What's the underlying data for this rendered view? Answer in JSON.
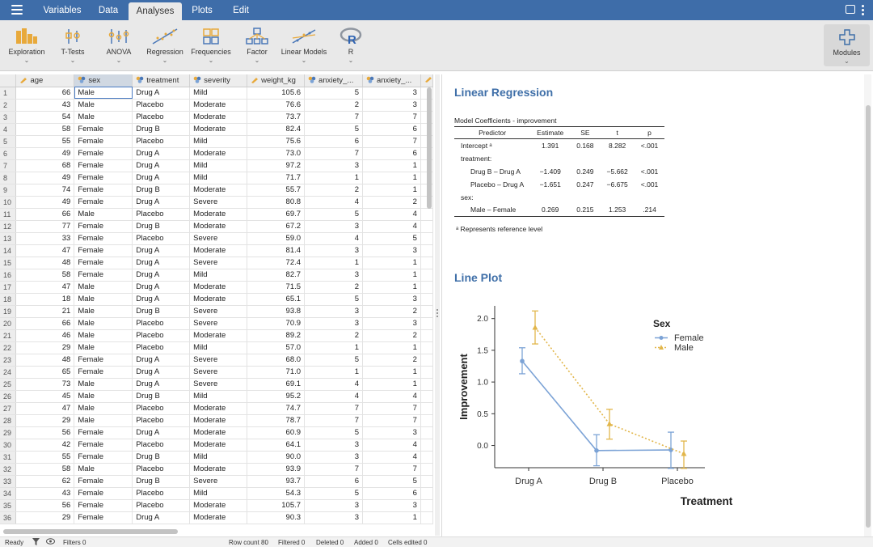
{
  "menu": {
    "tabs": [
      {
        "label": "Variables"
      },
      {
        "label": "Data"
      },
      {
        "label": "Analyses"
      },
      {
        "label": "Plots"
      },
      {
        "label": "Edit"
      }
    ]
  },
  "ribbon": {
    "buttons": [
      {
        "label": "Exploration",
        "icon": "exploration-icon"
      },
      {
        "label": "T-Tests",
        "icon": "ttests-icon"
      },
      {
        "label": "ANOVA",
        "icon": "anova-icon"
      },
      {
        "label": "Regression",
        "icon": "regression-icon"
      },
      {
        "label": "Frequencies",
        "icon": "frequencies-icon"
      },
      {
        "label": "Factor",
        "icon": "factor-icon"
      },
      {
        "label": "Linear Models",
        "icon": "linear-models-icon"
      },
      {
        "label": "R",
        "icon": "r-icon"
      }
    ],
    "modules_label": "Modules"
  },
  "grid": {
    "columns": [
      {
        "label": "age",
        "type": "continuous"
      },
      {
        "label": "sex",
        "type": "nominal"
      },
      {
        "label": "treatment",
        "type": "nominal"
      },
      {
        "label": "severity",
        "type": "nominal"
      },
      {
        "label": "weight_kg",
        "type": "continuous"
      },
      {
        "label": "anxiety_...",
        "type": "nominal"
      },
      {
        "label": "anxiety_...",
        "type": "nominal"
      }
    ],
    "rows": [
      [
        "1",
        "66",
        "Male",
        "Drug A",
        "Mild",
        "105.6",
        "5",
        "3"
      ],
      [
        "2",
        "43",
        "Male",
        "Placebo",
        "Moderate",
        "76.6",
        "2",
        "3"
      ],
      [
        "3",
        "54",
        "Male",
        "Placebo",
        "Moderate",
        "73.7",
        "7",
        "7"
      ],
      [
        "4",
        "58",
        "Female",
        "Drug B",
        "Moderate",
        "82.4",
        "5",
        "6"
      ],
      [
        "5",
        "55",
        "Female",
        "Placebo",
        "Mild",
        "75.6",
        "6",
        "7"
      ],
      [
        "6",
        "49",
        "Female",
        "Drug A",
        "Moderate",
        "73.0",
        "7",
        "6"
      ],
      [
        "7",
        "68",
        "Female",
        "Drug A",
        "Mild",
        "97.2",
        "3",
        "1"
      ],
      [
        "8",
        "49",
        "Female",
        "Drug A",
        "Mild",
        "71.7",
        "1",
        "1"
      ],
      [
        "9",
        "74",
        "Female",
        "Drug B",
        "Moderate",
        "55.7",
        "2",
        "1"
      ],
      [
        "10",
        "49",
        "Female",
        "Drug A",
        "Severe",
        "80.8",
        "4",
        "2"
      ],
      [
        "11",
        "66",
        "Male",
        "Placebo",
        "Moderate",
        "69.7",
        "5",
        "4"
      ],
      [
        "12",
        "77",
        "Female",
        "Drug B",
        "Moderate",
        "67.2",
        "3",
        "4"
      ],
      [
        "13",
        "33",
        "Female",
        "Placebo",
        "Severe",
        "59.0",
        "4",
        "5"
      ],
      [
        "14",
        "47",
        "Female",
        "Drug A",
        "Moderate",
        "81.4",
        "3",
        "3"
      ],
      [
        "15",
        "48",
        "Female",
        "Drug A",
        "Severe",
        "72.4",
        "1",
        "1"
      ],
      [
        "16",
        "58",
        "Female",
        "Drug A",
        "Mild",
        "82.7",
        "3",
        "1"
      ],
      [
        "17",
        "47",
        "Male",
        "Drug A",
        "Moderate",
        "71.5",
        "2",
        "1"
      ],
      [
        "18",
        "18",
        "Male",
        "Drug A",
        "Moderate",
        "65.1",
        "5",
        "3"
      ],
      [
        "19",
        "21",
        "Male",
        "Drug B",
        "Severe",
        "93.8",
        "3",
        "2"
      ],
      [
        "20",
        "66",
        "Male",
        "Placebo",
        "Severe",
        "70.9",
        "3",
        "3"
      ],
      [
        "21",
        "46",
        "Male",
        "Placebo",
        "Moderate",
        "89.2",
        "2",
        "2"
      ],
      [
        "22",
        "29",
        "Male",
        "Placebo",
        "Mild",
        "57.0",
        "1",
        "1"
      ],
      [
        "23",
        "48",
        "Female",
        "Drug A",
        "Severe",
        "68.0",
        "5",
        "2"
      ],
      [
        "24",
        "65",
        "Female",
        "Drug A",
        "Severe",
        "71.0",
        "1",
        "1"
      ],
      [
        "25",
        "73",
        "Male",
        "Drug A",
        "Severe",
        "69.1",
        "4",
        "1"
      ],
      [
        "26",
        "45",
        "Male",
        "Drug B",
        "Mild",
        "95.2",
        "4",
        "4"
      ],
      [
        "27",
        "47",
        "Male",
        "Placebo",
        "Moderate",
        "74.7",
        "7",
        "7"
      ],
      [
        "28",
        "29",
        "Male",
        "Placebo",
        "Moderate",
        "78.7",
        "7",
        "7"
      ],
      [
        "29",
        "56",
        "Female",
        "Drug A",
        "Moderate",
        "60.9",
        "5",
        "3"
      ],
      [
        "30",
        "42",
        "Female",
        "Placebo",
        "Moderate",
        "64.1",
        "3",
        "4"
      ],
      [
        "31",
        "55",
        "Female",
        "Drug B",
        "Mild",
        "90.0",
        "3",
        "4"
      ],
      [
        "32",
        "58",
        "Male",
        "Placebo",
        "Moderate",
        "93.9",
        "7",
        "7"
      ],
      [
        "33",
        "62",
        "Female",
        "Drug B",
        "Severe",
        "93.7",
        "6",
        "5"
      ],
      [
        "34",
        "43",
        "Female",
        "Placebo",
        "Mild",
        "54.3",
        "5",
        "6"
      ],
      [
        "35",
        "56",
        "Female",
        "Placebo",
        "Moderate",
        "105.7",
        "3",
        "3"
      ],
      [
        "36",
        "29",
        "Female",
        "Drug A",
        "Moderate",
        "90.3",
        "3",
        "1"
      ]
    ]
  },
  "results": {
    "regression": {
      "title": "Linear Regression",
      "table_title": "Model Coefficients - improvement",
      "headers": [
        "Predictor",
        "Estimate",
        "SE",
        "t",
        "p"
      ],
      "rows": [
        {
          "label": "Intercept ᵃ",
          "estimate": "1.391",
          "se": "0.168",
          "t": "8.282",
          "p": "<.001"
        },
        {
          "label": "treatment:",
          "estimate": "",
          "se": "",
          "t": "",
          "p": ""
        },
        {
          "label": "Drug B – Drug A",
          "estimate": "−1.409",
          "se": "0.249",
          "t": "−5.662",
          "p": "<.001"
        },
        {
          "label": "Placebo – Drug A",
          "estimate": "−1.651",
          "se": "0.247",
          "t": "−6.675",
          "p": "<.001"
        },
        {
          "label": "sex:",
          "estimate": "",
          "se": "",
          "t": "",
          "p": ""
        },
        {
          "label": "Male – Female",
          "estimate": "0.269",
          "se": "0.215",
          "t": "1.253",
          "p": ".214"
        }
      ],
      "footnote": "ᵃ Represents reference level"
    },
    "lineplot": {
      "title": "Line Plot"
    }
  },
  "chart_data": {
    "type": "line",
    "categories": [
      "Drug A",
      "Drug B",
      "Placebo"
    ],
    "xlabel": "Treatment",
    "ylabel": "Improvement",
    "ylim": [
      -0.35,
      2.2
    ],
    "yticks": [
      0.0,
      0.5,
      1.0,
      1.5,
      2.0
    ],
    "ytick_labels": [
      "0.0",
      "0.5",
      "1.0",
      "1.5",
      "2.0"
    ],
    "legend_title": "Sex",
    "legend_position": "right",
    "series": [
      {
        "name": "Female",
        "color": "#7ca3d6",
        "marker": "circle",
        "dash": "solid",
        "values": [
          1.33,
          -0.08,
          -0.07
        ],
        "lower": [
          1.13,
          -0.32,
          -0.36
        ],
        "upper": [
          1.54,
          0.17,
          0.21
        ]
      },
      {
        "name": "Male",
        "color": "#e2b64a",
        "marker": "triangle",
        "dash": "dotted",
        "values": [
          1.86,
          0.34,
          -0.13
        ],
        "lower": [
          1.6,
          0.1,
          -0.36
        ],
        "upper": [
          2.12,
          0.57,
          0.07
        ]
      }
    ]
  },
  "statusbar": {
    "ready": "Ready",
    "filters": "Filters 0",
    "row_count": "Row count 80",
    "filtered": "Filtered 0",
    "deleted": "Deleted 0",
    "added": "Added 0",
    "cells_edited": "Cells edited 0"
  }
}
